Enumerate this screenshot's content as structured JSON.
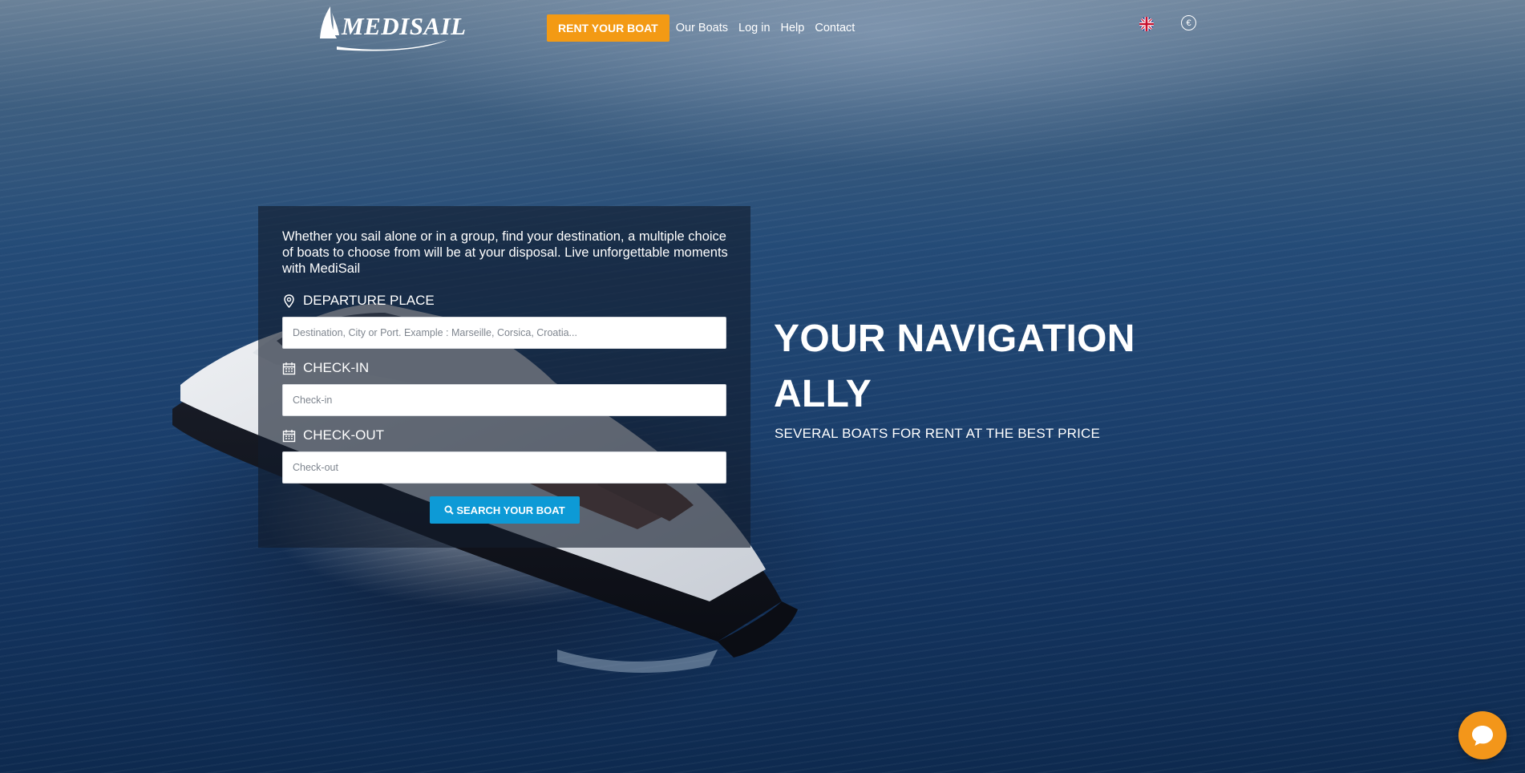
{
  "header": {
    "logo_text": "MEDISAIL",
    "rent_button_label": "RENT YOUR BOAT",
    "nav_links": [
      "Our Boats",
      "Log in",
      "Help",
      "Contact"
    ],
    "language_icon": "uk-flag-icon",
    "currency_symbol": "€"
  },
  "search_panel": {
    "intro": "Whether you sail alone or in a group, find your destination, a multiple choice of boats to choose from will be at your disposal. Live unforgettable moments with MediSail",
    "departure": {
      "label": "DEPARTURE PLACE",
      "placeholder": "Destination, City or Port. Example : Marseille, Corsica, Croatia...",
      "icon": "map-pin-icon"
    },
    "checkin": {
      "label": "CHECK-IN",
      "placeholder": "Check-in",
      "icon": "calendar-icon"
    },
    "checkout": {
      "label": "CHECK-OUT",
      "placeholder": "Check-out",
      "icon": "calendar-icon"
    },
    "search_button_label": "SEARCH YOUR BOAT"
  },
  "hero": {
    "title": "YOUR NAVIGATION ALLY",
    "subtitle": "SEVERAL BOATS FOR RENT AT THE BEST PRICE"
  },
  "colors": {
    "accent_orange": "#f39a14",
    "search_blue": "#0d9ad6",
    "chat_orange": "#f3961a"
  },
  "chat": {
    "icon": "chat-bubble-icon"
  }
}
